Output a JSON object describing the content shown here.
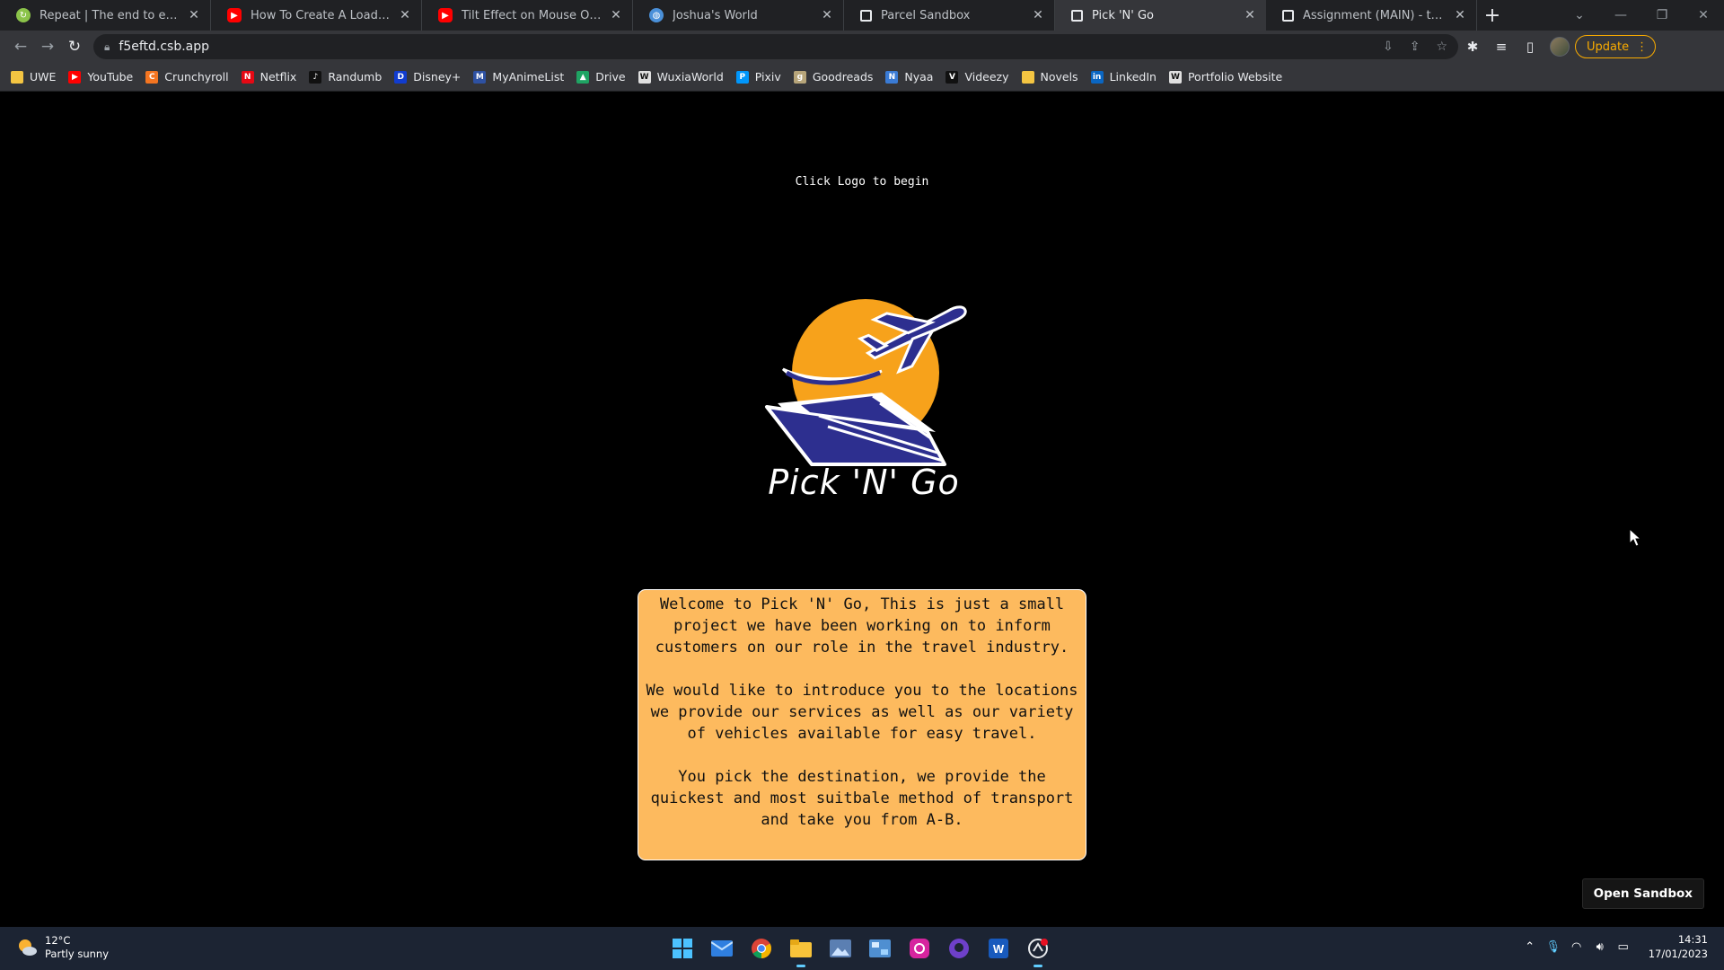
{
  "browser": {
    "tabs": [
      {
        "title": "Repeat | The end to end reorder",
        "icon": "repeat-favicon",
        "color": "#8bc34a"
      },
      {
        "title": "How To Create A Loading Screen",
        "icon": "youtube-icon",
        "color": "#ff0000"
      },
      {
        "title": "Tilt Effect on Mouse Over (HTML",
        "icon": "youtube-icon",
        "color": "#ff0000"
      },
      {
        "title": "Joshua's World",
        "icon": "globe-icon",
        "color": "#4a90d9"
      },
      {
        "title": "Parcel Sandbox",
        "icon": "codesandbox-icon",
        "color": "#ffffff"
      },
      {
        "title": "Pick 'N' Go",
        "icon": "codesandbox-icon",
        "color": "#ffffff"
      },
      {
        "title": "Assignment (MAIN) - text - Cod",
        "icon": "codesandbox-icon",
        "color": "#ffffff"
      }
    ],
    "active_tab_index": 5,
    "url": "f5eftd.csb.app",
    "update_label": "Update"
  },
  "bookmarks": [
    {
      "label": "UWE",
      "icon": "folder-icon",
      "color": "#f4c542"
    },
    {
      "label": "YouTube",
      "icon": "youtube-icon",
      "color": "#ff0000"
    },
    {
      "label": "Crunchyroll",
      "icon": "crunchyroll-icon",
      "color": "#f47521"
    },
    {
      "label": "Netflix",
      "icon": "netflix-icon",
      "color": "#e50914"
    },
    {
      "label": "Randumb",
      "icon": "tiktok-icon",
      "color": "#111111"
    },
    {
      "label": "Disney+",
      "icon": "disney-icon",
      "color": "#113ccf"
    },
    {
      "label": "MyAnimeList",
      "icon": "myanimelist-icon",
      "color": "#2e51a2"
    },
    {
      "label": "Drive",
      "icon": "drive-icon",
      "color": "#1fa463"
    },
    {
      "label": "WuxiaWorld",
      "icon": "wuxiaworld-icon",
      "color": "#e0e0e0"
    },
    {
      "label": "Pixiv",
      "icon": "pixiv-icon",
      "color": "#0096fa"
    },
    {
      "label": "Goodreads",
      "icon": "goodreads-icon",
      "color": "#b7a57a"
    },
    {
      "label": "Nyaa",
      "icon": "nyaa-icon",
      "color": "#3a7bd5"
    },
    {
      "label": "Videezy",
      "icon": "videezy-icon",
      "color": "#111111"
    },
    {
      "label": "Novels",
      "icon": "folder-icon",
      "color": "#f4c542"
    },
    {
      "label": "LinkedIn",
      "icon": "linkedin-icon",
      "color": "#0a66c2"
    },
    {
      "label": "Portfolio Website",
      "icon": "wix-icon",
      "color": "#e0e0e0"
    }
  ],
  "page": {
    "hint": "Click Logo to begin",
    "logo_text": "Pick 'N' Go",
    "welcome_paragraphs": [
      "Welcome to Pick 'N' Go, This is just a small project we have been working on to inform customers on our role in the travel industry.",
      "We would like to introduce you to the locations we provide our services as well as our variety of vehicles available for easy travel.",
      "You pick the destination, we provide the quickest and most suitbale method of transport and take you from A-B."
    ],
    "open_sandbox_label": "Open Sandbox",
    "colors": {
      "sun": "#f7a21b",
      "navy": "#2d2f8f",
      "panel": "#fdba5e"
    }
  },
  "taskbar": {
    "weather_temp": "12°C",
    "weather_desc": "Partly sunny",
    "time": "14:31",
    "date": "17/01/2023",
    "apps": [
      "windows-start-icon",
      "mail-icon",
      "chrome-icon",
      "file-explorer-icon",
      "photos-icon",
      "control-panel-icon",
      "instagram-icon",
      "github-icon",
      "word-icon",
      "codesandbox-app-icon"
    ]
  }
}
